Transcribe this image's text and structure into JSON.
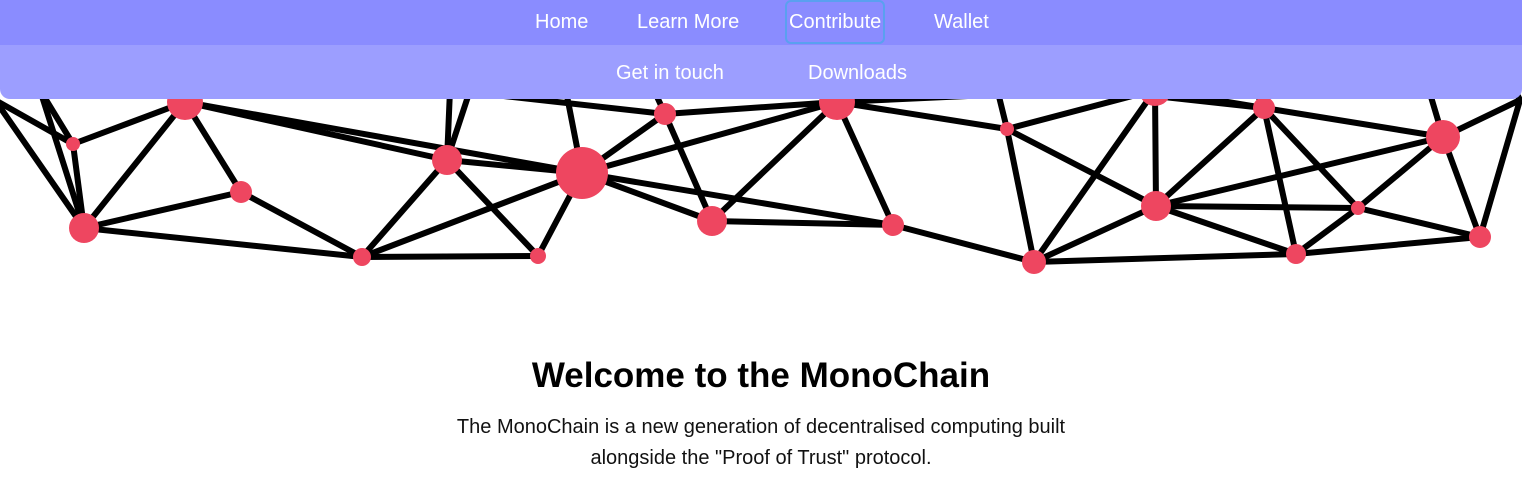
{
  "nav": {
    "primary": [
      {
        "label": "Home"
      },
      {
        "label": "Learn More"
      },
      {
        "label": "Contribute",
        "active": true
      },
      {
        "label": "Wallet"
      }
    ],
    "secondary": [
      {
        "label": "Get in touch"
      },
      {
        "label": "Downloads"
      }
    ],
    "colors": {
      "primary_bar": "#8a8cff",
      "secondary_bar": "#9c9eff",
      "focus_outline": "#5aa0f0"
    }
  },
  "hero": {
    "title": "Welcome to the MonoChain",
    "description": "The MonoChain is a new generation of decentralised computing built alongside the \"Proof of Trust\" protocol."
  },
  "graphic": {
    "node_color": "#ee4660",
    "edge_color": "#000000"
  }
}
